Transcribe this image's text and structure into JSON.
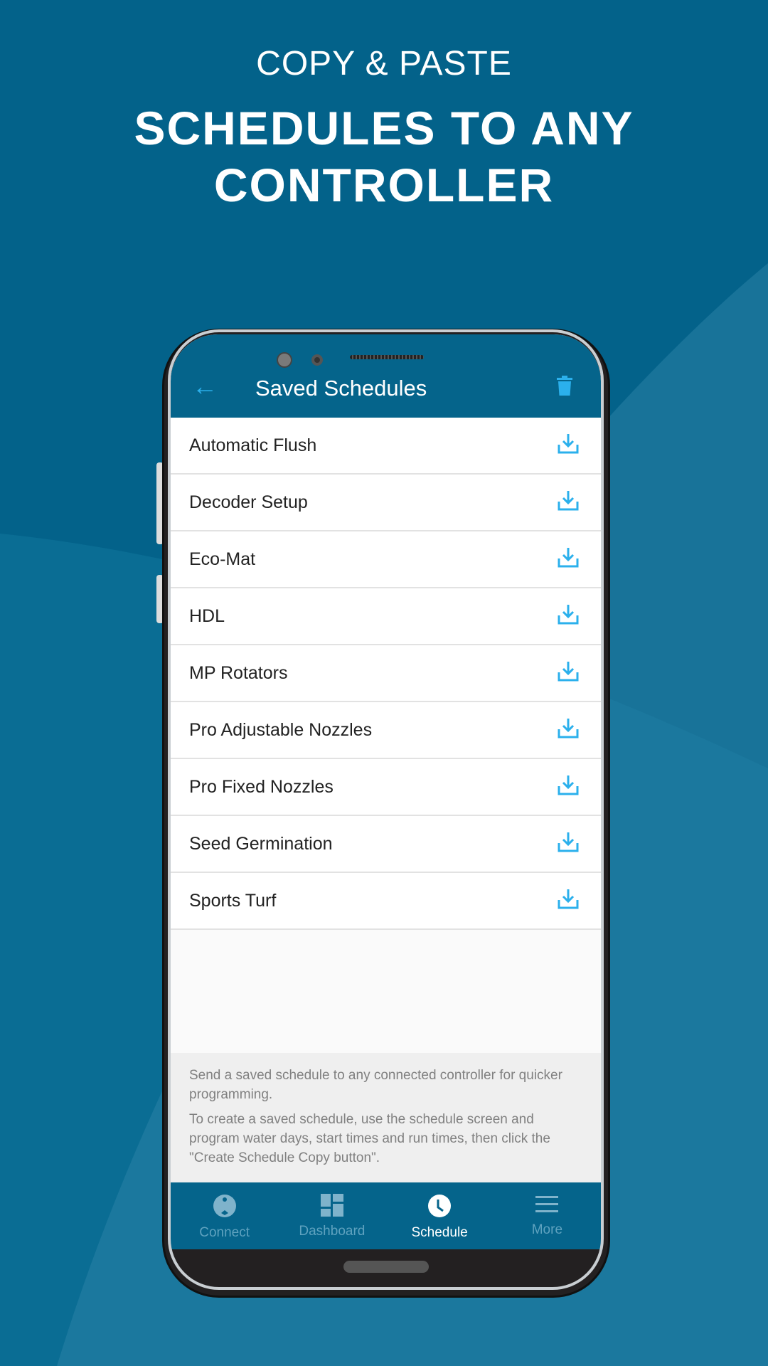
{
  "promo": {
    "line1": "COPY & PASTE",
    "line2": "SCHEDULES TO ANY",
    "line3": "CONTROLLER"
  },
  "appbar": {
    "title": "Saved Schedules",
    "back_icon": "arrow-left-icon",
    "action_icon": "trash-icon"
  },
  "schedules": [
    {
      "label": "Automatic Flush"
    },
    {
      "label": "Decoder Setup"
    },
    {
      "label": "Eco-Mat"
    },
    {
      "label": "HDL"
    },
    {
      "label": "MP Rotators"
    },
    {
      "label": "Pro Adjustable Nozzles"
    },
    {
      "label": "Pro Fixed Nozzles"
    },
    {
      "label": "Seed Germination"
    },
    {
      "label": "Sports Turf"
    }
  ],
  "info": {
    "p1": "Send a saved schedule to any connected controller for quicker programming.",
    "p2": "To create a saved schedule, use the schedule screen and program water days, start times and run times, then click the \"Create Schedule Copy button\"."
  },
  "nav": [
    {
      "label": "Connect",
      "icon": "connect-icon"
    },
    {
      "label": "Dashboard",
      "icon": "dashboard-icon"
    },
    {
      "label": "Schedule",
      "icon": "clock-icon",
      "active": true
    },
    {
      "label": "More",
      "icon": "menu-icon"
    }
  ],
  "colors": {
    "background": "#03628a",
    "appbar": "#05648b",
    "accent": "#2bb0ec"
  }
}
